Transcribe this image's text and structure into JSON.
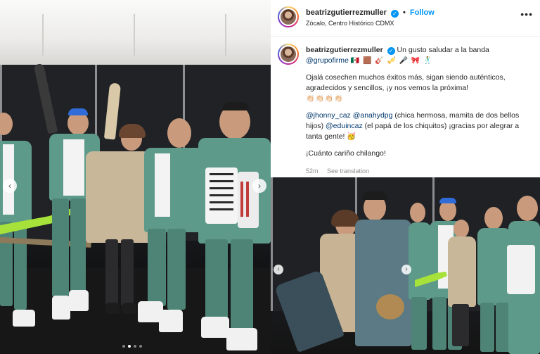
{
  "post": {
    "username": "beatrizgutierrezmuller",
    "verified_icon": "✓",
    "follow_label": "Follow",
    "separator": "•",
    "location": "Zócalo, Centro Histórico CDMX",
    "more_icon": "•••"
  },
  "caption": {
    "username": "beatrizgutierrezmuller",
    "line1_text": "Un gusto saludar a la banda",
    "line1_mention": "@grupofirme",
    "line1_emojis": "🇲🇽 🟫 🎸 🎺 🎤 🎀 🕺",
    "paragraph2": "Ojalá cosechen muchos éxitos más, sigan siendo auténticos, agradecidos y sencillos, ¡y nos vemos la próxima!",
    "paragraph2_emojis": "👏🏻👏🏻👏🏻👏🏻",
    "mention_a": "@jhonny_caz",
    "mention_b": "@anahydpg",
    "text_b": "(chica hermosa, mamita de dos bellos hijos)",
    "mention_c": "@eduincaz",
    "text_c": "(el papá de los chiquitos) ¡gracias por alegrar a tanta gente!",
    "emoji_c": "🥳",
    "closing": "¡Cuánto cariño chilango!"
  },
  "meta": {
    "time": "52m",
    "translation_label": "See translation"
  },
  "carousel": {
    "prev_icon": "‹",
    "next_icon": "›",
    "dot_count": 4,
    "active_dot": 2
  },
  "colors": {
    "follow_blue": "#0095f6",
    "mention_blue": "#00376b",
    "outfit_teal": "#5e9a8a",
    "guitar_green": "#a6e23a"
  }
}
